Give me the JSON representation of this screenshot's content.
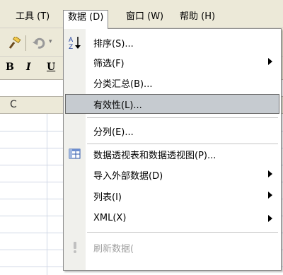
{
  "menubar": {
    "items": [
      {
        "label": "工具 (T)"
      },
      {
        "label": "数据 (D)"
      },
      {
        "label": "窗口 (W)"
      },
      {
        "label": "帮助 (H)"
      }
    ]
  },
  "toolbar": {
    "bold": "B",
    "italic": "I",
    "underline": "U"
  },
  "sheet": {
    "column_letter": "C"
  },
  "data_menu": {
    "items": [
      {
        "label": "排序(S)...",
        "icon": "sort-az-icon",
        "submenu": false
      },
      {
        "label": "筛选(F)",
        "submenu": true
      },
      {
        "label": "分类汇总(B)...",
        "submenu": false
      },
      {
        "label": "有效性(L)...",
        "submenu": false,
        "highlighted": true
      },
      {
        "label": "分列(E)...",
        "submenu": false
      },
      {
        "label": "数据透视表和数据透视图(P)...",
        "icon": "pivot-table-icon",
        "submenu": false
      },
      {
        "label": "导入外部数据(D)",
        "submenu": true
      },
      {
        "label": "列表(I)",
        "submenu": true
      },
      {
        "label": "XML(X)",
        "submenu": true
      },
      {
        "label": "刷新数据(",
        "icon": "refresh-exclamation-icon",
        "submenu": false,
        "disabled": true
      }
    ]
  },
  "colors": {
    "menu_highlight": "#c6cbd0",
    "toolbar_bg": "#ece9d8",
    "disabled_text": "#a0a0a0"
  }
}
